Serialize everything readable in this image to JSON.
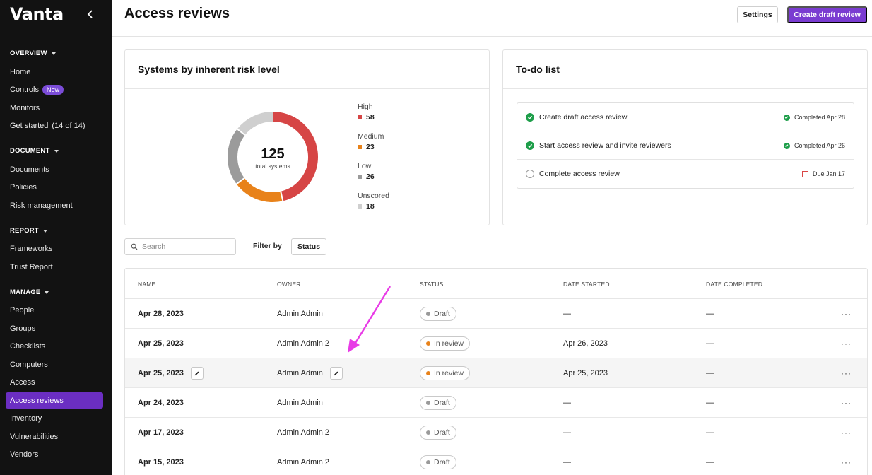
{
  "sidebar": {
    "logo": "Vanta",
    "sections": [
      {
        "title": "OVERVIEW",
        "items": [
          "Home",
          "Controls",
          "Monitors",
          "Get started"
        ]
      },
      {
        "title": "DOCUMENT",
        "items": [
          "Documents",
          "Policies",
          "Risk management"
        ]
      },
      {
        "title": "REPORT",
        "items": [
          "Frameworks",
          "Trust Report"
        ]
      },
      {
        "title": "MANAGE",
        "items": [
          "People",
          "Groups",
          "Checklists",
          "Computers",
          "Access",
          "Access reviews",
          "Inventory",
          "Vulnerabilities",
          "Vendors"
        ]
      }
    ],
    "controls_badge": "New",
    "get_started_count": "(14 of 14)",
    "active_item": "Access reviews"
  },
  "header": {
    "title": "Access reviews",
    "settings_label": "Settings",
    "create_label": "Create draft review"
  },
  "risk_card": {
    "title": "Systems by inherent risk level",
    "total": "125",
    "total_label": "total systems",
    "levels": [
      {
        "label": "High",
        "value": 58,
        "color": "#d64545"
      },
      {
        "label": "Medium",
        "value": 23,
        "color": "#e8821a"
      },
      {
        "label": "Low",
        "value": 26,
        "color": "#9b9b9b"
      },
      {
        "label": "Unscored",
        "value": 18,
        "color": "#cfcfcf"
      }
    ]
  },
  "todo_card": {
    "title": "To-do list",
    "items": [
      {
        "text": "Create draft access review",
        "done": true,
        "status": "Completed Apr 28"
      },
      {
        "text": "Start access review and invite reviewers",
        "done": true,
        "status": "Completed Apr 26"
      },
      {
        "text": "Complete access review",
        "done": false,
        "status": "Due Jan 17"
      }
    ]
  },
  "filters": {
    "search_placeholder": "Search",
    "filter_by_label": "Filter by",
    "status_button": "Status"
  },
  "table": {
    "columns": [
      "NAME",
      "OWNER",
      "STATUS",
      "DATE STARTED",
      "DATE COMPLETED"
    ],
    "rows": [
      {
        "name": "Apr 28, 2023",
        "owner": "Admin Admin",
        "status": "Draft",
        "started": "—",
        "completed": "—"
      },
      {
        "name": "Apr 25, 2023",
        "owner": "Admin Admin 2",
        "status": "In review",
        "started": "Apr 26, 2023",
        "completed": "—"
      },
      {
        "name": "Apr 25, 2023",
        "owner": "Admin Admin",
        "status": "In review",
        "started": "Apr 25, 2023",
        "completed": "—"
      },
      {
        "name": "Apr 24, 2023",
        "owner": "Admin Admin",
        "status": "Draft",
        "started": "—",
        "completed": "—"
      },
      {
        "name": "Apr 17, 2023",
        "owner": "Admin Admin 2",
        "status": "Draft",
        "started": "—",
        "completed": "—"
      },
      {
        "name": "Apr 15, 2023",
        "owner": "Admin Admin 2",
        "status": "Draft",
        "started": "—",
        "completed": "—"
      }
    ],
    "more_label": "···",
    "status_colors": {
      "Draft": "#9a9a9a",
      "In review": "#e8821a"
    }
  },
  "colors": {
    "accent": "#7a3cd1",
    "annotation": "#e83be6",
    "success": "#1e9e4a"
  }
}
